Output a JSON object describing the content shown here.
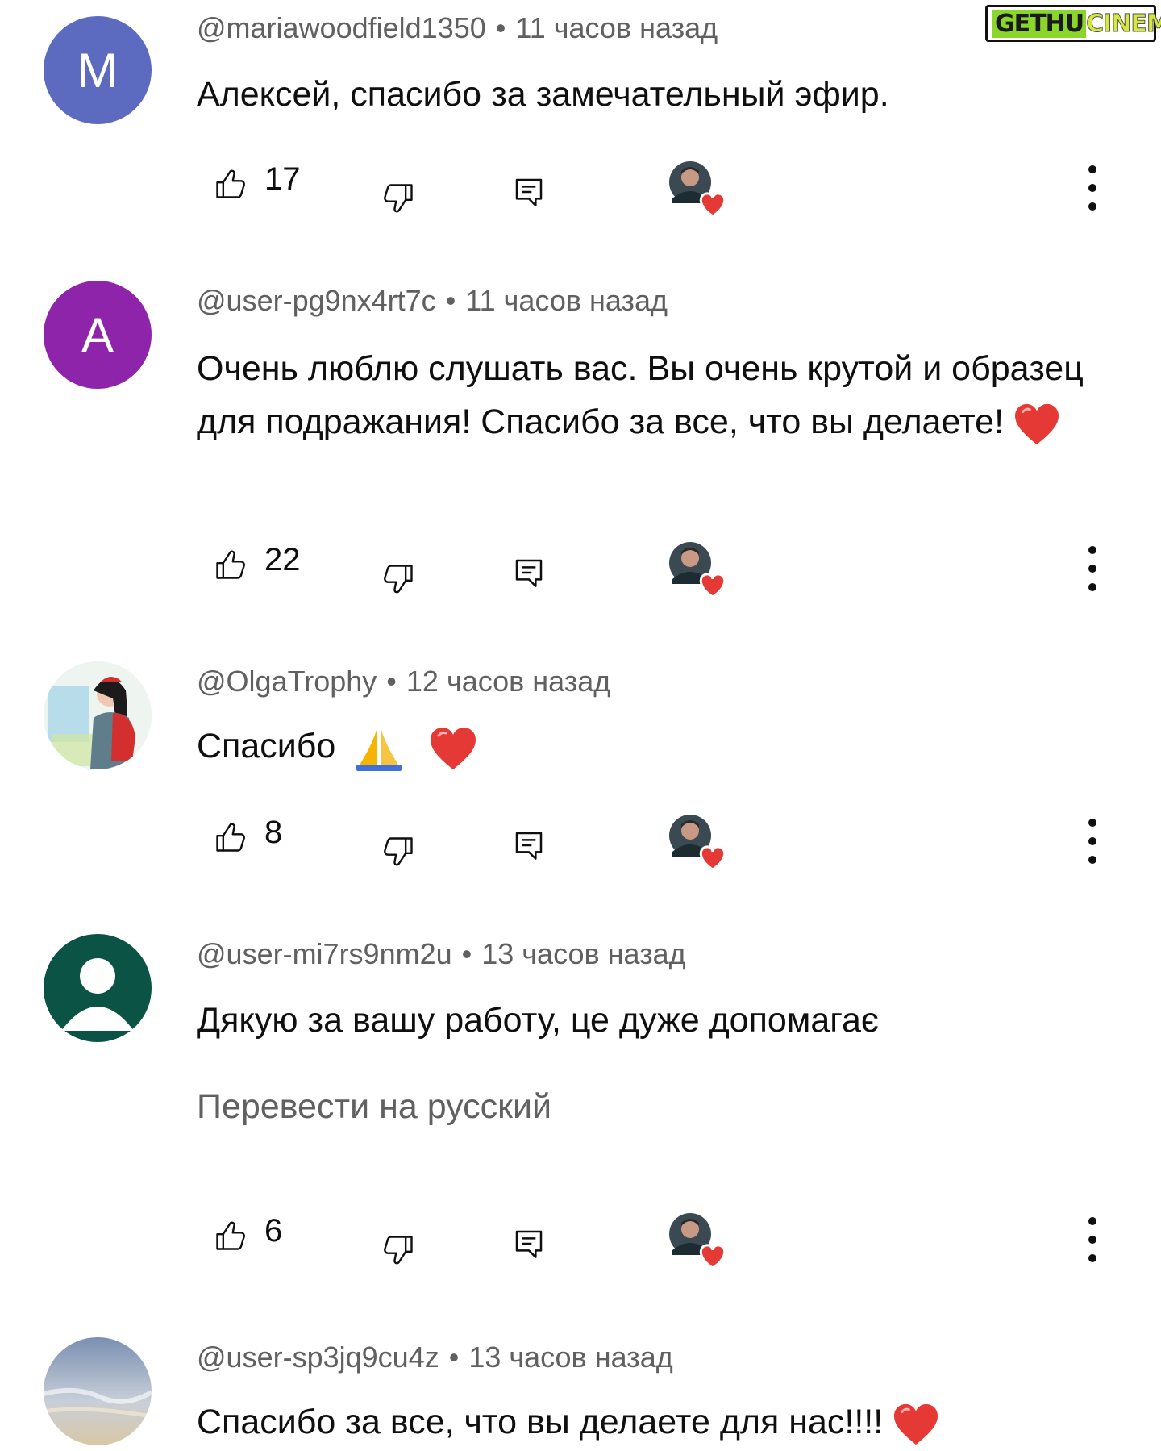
{
  "watermark": {
    "part1": "GETHU",
    "part2": "CINEMA"
  },
  "comments": [
    {
      "avatar_letter": "M",
      "avatar_color": "#5c6bc0",
      "author": "@mariawoodfield1350",
      "time": "11 часов назад",
      "text": "Алексей, спасибо за замечательный эфир.",
      "likes": "17"
    },
    {
      "avatar_letter": "A",
      "avatar_color": "#8e24aa",
      "author": "@user-pg9nx4rt7c",
      "time": "11 часов назад",
      "text": "Очень люблю слушать вас. Вы очень крутой и образец для подражания! Спасибо за все, что вы делаете!",
      "likes": "22"
    },
    {
      "avatar_letter": "",
      "author": "@OlgaTrophy",
      "time": "12 часов назад",
      "text": "Спасибо",
      "likes": "8"
    },
    {
      "avatar_letter": "",
      "avatar_color": "#0b5345",
      "author": "@user-mi7rs9nm2u",
      "time": "13 часов назад",
      "text": "Дякую за вашу работу, це дуже допомагає",
      "translate": "Перевести на русский",
      "likes": "6"
    },
    {
      "avatar_letter": "",
      "author": "@user-sp3jq9cu4z",
      "time": "13 часов назад",
      "text": "Спасибо за все, что вы делаете для нас!!!!"
    }
  ],
  "colors": {
    "heart": "#e53935",
    "meta": "#606060"
  }
}
